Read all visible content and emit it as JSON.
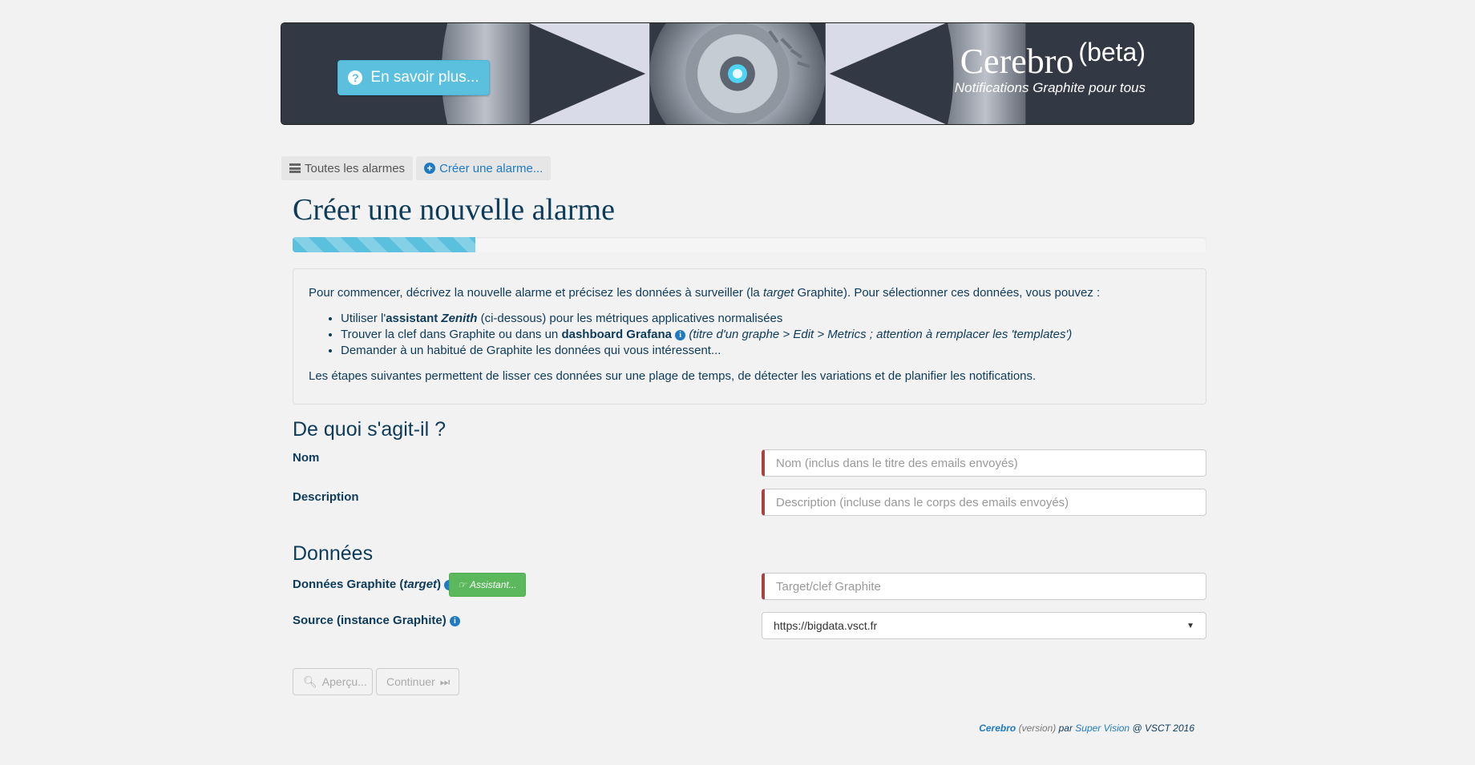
{
  "banner": {
    "info_button": "En savoir plus...",
    "title": "Cerebro",
    "beta": "(beta)",
    "subtitle": "Notifications Graphite pour tous"
  },
  "tabs": [
    {
      "label": "Toutes les alarmes",
      "icon": "list-icon"
    },
    {
      "label": "Créer une alarme...",
      "icon": "plus-circle-icon"
    }
  ],
  "page": {
    "title": "Créer une nouvelle alarme",
    "progress_percent": 20
  },
  "intro": {
    "lead_before": "Pour commencer, décrivez la nouvelle alarme et précisez les données à surveiller (la ",
    "lead_em": "target",
    "lead_after": " Graphite). Pour sélectionner ces données, vous pouvez :",
    "item1_a": "Utiliser l'",
    "item1_b": "assistant ",
    "item1_c": "Zenith",
    "item1_d": " (ci-dessous) pour les métriques applicatives normalisées",
    "item2_a": "Trouver la clef dans Graphite ou dans un ",
    "item2_b": "dashboard Grafana",
    "item2_c": " (titre d'un graphe > Edit > Metrics ; attention à remplacer les 'templates')",
    "item3": "Demander à un habitué de Graphite les données qui vous intéressent...",
    "closing": "Les étapes suivantes permettent de lisser ces données sur une plage de temps, de détecter les variations et de planifier les notifications."
  },
  "section1": {
    "heading": "De quoi s'agit-il ?",
    "name_label": "Nom",
    "name_placeholder": "Nom (inclus dans le titre des emails envoyés)",
    "desc_label": "Description",
    "desc_placeholder": "Description (incluse dans le corps des emails envoyés)"
  },
  "section2": {
    "heading": "Données",
    "target_label_a": "Données Graphite (",
    "target_label_em": "target",
    "target_label_b": ")",
    "assistant_button": "Assistant...",
    "target_placeholder": "Target/clef Graphite",
    "source_label": "Source (instance Graphite)",
    "source_value": "https://bigdata.vsct.fr"
  },
  "actions": {
    "preview": "Aperçu...",
    "continue": "Continuer"
  },
  "footer": {
    "brand": "Cerebro",
    "version": "(version)",
    "par": " par ",
    "team": "Super Vision",
    "copy": " @ VSCT 2016"
  },
  "colors": {
    "accent": "#5bc0de",
    "link": "#1f7ac2",
    "text": "#0d3b5a",
    "success": "#5cb85c",
    "error": "#a94442"
  }
}
